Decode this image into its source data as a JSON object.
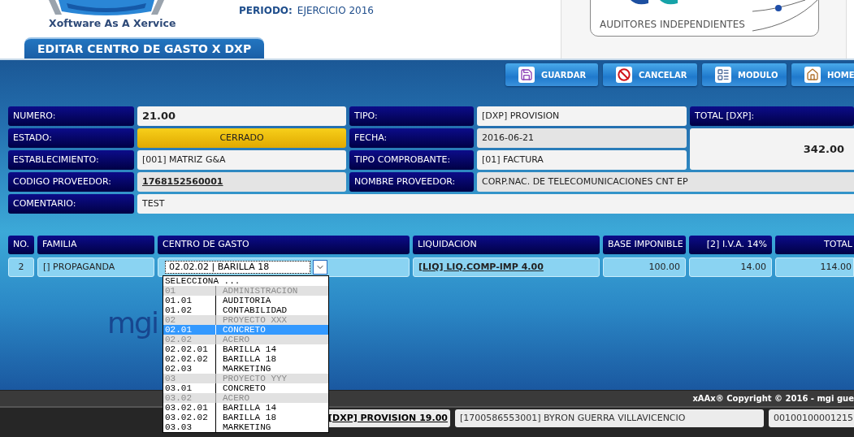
{
  "header": {
    "tagline": "Xoftware As A Xervice",
    "periodo_label": "PERIODO:",
    "periodo_value": "EJERCICIO 2016",
    "auditor_tagline": "AUDITORES INDEPENDIENTES"
  },
  "section_tab": {
    "label": "EDITAR CENTRO DE GASTO X DXP",
    "selected": true
  },
  "toolbar": [
    {
      "label": "GUARDAR",
      "kind": "save"
    },
    {
      "label": "CANCELAR",
      "kind": "cancel"
    },
    {
      "label": "MODULO",
      "kind": "module"
    },
    {
      "label": "HOME",
      "kind": "home"
    }
  ],
  "form": {
    "numero": {
      "label": "NUMERO:",
      "value": "21.00",
      "kind": "bold"
    },
    "tipo": {
      "label": "TIPO:",
      "value": "[DXP] PROVISION",
      "kind": "text"
    },
    "total": {
      "label": "TOTAL [DXP]:",
      "value": "342.00",
      "kind": "bold"
    },
    "estado": {
      "label": "ESTADO:",
      "value": "CERRADO",
      "kind": "status"
    },
    "fecha": {
      "label": "FECHA:",
      "value": "2016-06-21",
      "kind": "readonly"
    },
    "establecimiento": {
      "label": "ESTABLECIMIENTO:",
      "value": "[001] MATRIZ G&A",
      "kind": "text"
    },
    "tipo_comprobante": {
      "label": "TIPO COMPROBANTE:",
      "value": "[01] FACTURA",
      "kind": "text"
    },
    "codigo_proveedor": {
      "label": "CODIGO PROVEEDOR:",
      "value": "1768152560001",
      "kind": "link"
    },
    "nombre_proveedor": {
      "label": "NOMBRE PROVEEDOR:",
      "value": "CORP.NAC. DE TELECOMUNICACIONES CNT EP",
      "kind": "readonly"
    },
    "comentario": {
      "label": "COMENTARIO:",
      "value": "TEST",
      "kind": "text"
    }
  },
  "background_logo": {
    "text": "mgi"
  },
  "table": {
    "columns": [
      {
        "label": "NO."
      },
      {
        "label": "FAMILIA"
      },
      {
        "label": "CENTRO DE GASTO"
      },
      {
        "label": "LIQUIDACION"
      },
      {
        "label": "BASE IMPONIBLE"
      },
      {
        "label": "[2] I.V.A. 14%"
      },
      {
        "label": "TOTAL"
      }
    ],
    "rows": [
      {
        "no": "2",
        "familia": "[] PROPAGANDA",
        "centro_de_gasto": {
          "value": "02.02.02 | BARILLA 18",
          "expanded": true,
          "options": [
            {
              "kind": "placeholder",
              "label": "SELECCIONA ...",
              "selected": false
            },
            {
              "kind": "group",
              "code": "01",
              "name": "ADMINISTRACION",
              "selected": false
            },
            {
              "kind": "item",
              "code": "01.01",
              "name": "AUDITORIA",
              "selected": false
            },
            {
              "kind": "item",
              "code": "01.02",
              "name": "CONTABILIDAD",
              "selected": false
            },
            {
              "kind": "group",
              "code": "02",
              "name": "PROYECTO XXX",
              "selected": false
            },
            {
              "kind": "item",
              "code": "02.01",
              "name": "CONCRETO",
              "selected": true
            },
            {
              "kind": "group",
              "code": "02.02",
              "name": "ACERO",
              "selected": false
            },
            {
              "kind": "item",
              "code": "02.02.01",
              "name": "BARILLA 14",
              "selected": false
            },
            {
              "kind": "item",
              "code": "02.02.02",
              "name": "BARILLA 18",
              "selected": false
            },
            {
              "kind": "item",
              "code": "02.03",
              "name": "MARKETING",
              "selected": false
            },
            {
              "kind": "group",
              "code": "03",
              "name": "PROYECTO YYY",
              "selected": false
            },
            {
              "kind": "item",
              "code": "03.01",
              "name": "CONCRETO",
              "selected": false
            },
            {
              "kind": "group",
              "code": "03.02",
              "name": "ACERO",
              "selected": false
            },
            {
              "kind": "item",
              "code": "03.02.01",
              "name": "BARILLA 14",
              "selected": false
            },
            {
              "kind": "item",
              "code": "03.02.02",
              "name": "BARILLA 18",
              "selected": false
            },
            {
              "kind": "item",
              "code": "03.03",
              "name": "MARKETING",
              "selected": false
            }
          ]
        },
        "liquidacion": "[LIQ] LIQ.COMP-IMP 4.00",
        "base_imponible": "100.00",
        "iva": "14.00",
        "total": "114.00"
      }
    ]
  },
  "footer": {
    "copyright": "xAAx® Copyright © 2016 - mgi gue"
  },
  "lower_table": {
    "rows": [
      {
        "document": "[DXP] PROVISION 19.00",
        "supplier": "[1700586553001] BYRON GUERRA VILLAVICENCIO",
        "number": "00100100001215"
      }
    ]
  }
}
